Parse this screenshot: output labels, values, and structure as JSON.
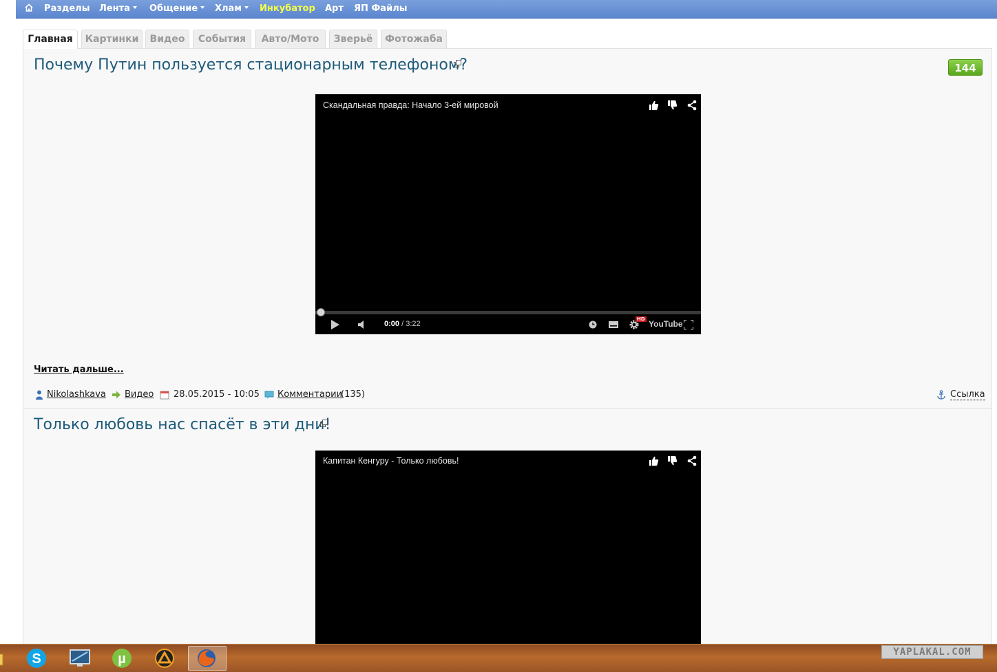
{
  "nav": {
    "home_icon": "home-icon",
    "items": [
      {
        "label": "Разделы",
        "dropdown": false
      },
      {
        "label": "Лента",
        "dropdown": true
      },
      {
        "label": "Общение",
        "dropdown": true
      },
      {
        "label": "Хлам",
        "dropdown": true
      },
      {
        "label": "Инкубатор",
        "dropdown": false,
        "highlight": "#f5ff4a"
      },
      {
        "label": "Арт",
        "dropdown": false
      },
      {
        "label": "ЯП Файлы",
        "dropdown": false
      }
    ]
  },
  "tabs": [
    {
      "label": "Главная",
      "active": true
    },
    {
      "label": "Картинки",
      "active": false
    },
    {
      "label": "Видео",
      "active": false
    },
    {
      "label": "События",
      "active": false
    },
    {
      "label": "Авто/Мото",
      "active": false
    },
    {
      "label": "Зверьё",
      "active": false
    },
    {
      "label": "Фотожаба",
      "active": false
    }
  ],
  "posts": [
    {
      "title": "Почему Путин пользуется стационарным телефоном?",
      "rating": "144",
      "video": {
        "title": "Скандальная правда: Начало 3-ей мировой",
        "time_current": "0:00",
        "time_total": "/ 3:22",
        "hd_badge": "HD",
        "logo": "YouTube"
      },
      "read_more": "Читать дальше...",
      "meta": {
        "author": "Nikolashkava",
        "section": "Видео",
        "date": "28.05.2015 - 10:05",
        "comments_label": "Комментарии",
        "comments_count": "(135)",
        "link_label": "Ссылка"
      }
    },
    {
      "title": "Только любовь нас спасёт в эти дни!",
      "video": {
        "title": "Капитан Кенгуру - Только любовь!"
      }
    }
  ],
  "taskbar": {
    "apps": [
      "folder-icon",
      "skype-icon",
      "monitor-icon",
      "utorrent-icon",
      "aimp-icon",
      "firefox-icon"
    ],
    "watermark": "YAPLAKAL.COM"
  },
  "colors": {
    "nav_bg": "#5b86cf",
    "title_link": "#1d5a7a",
    "rating_bg": "#6bb52a",
    "taskbar_bg": "#a85e28"
  }
}
